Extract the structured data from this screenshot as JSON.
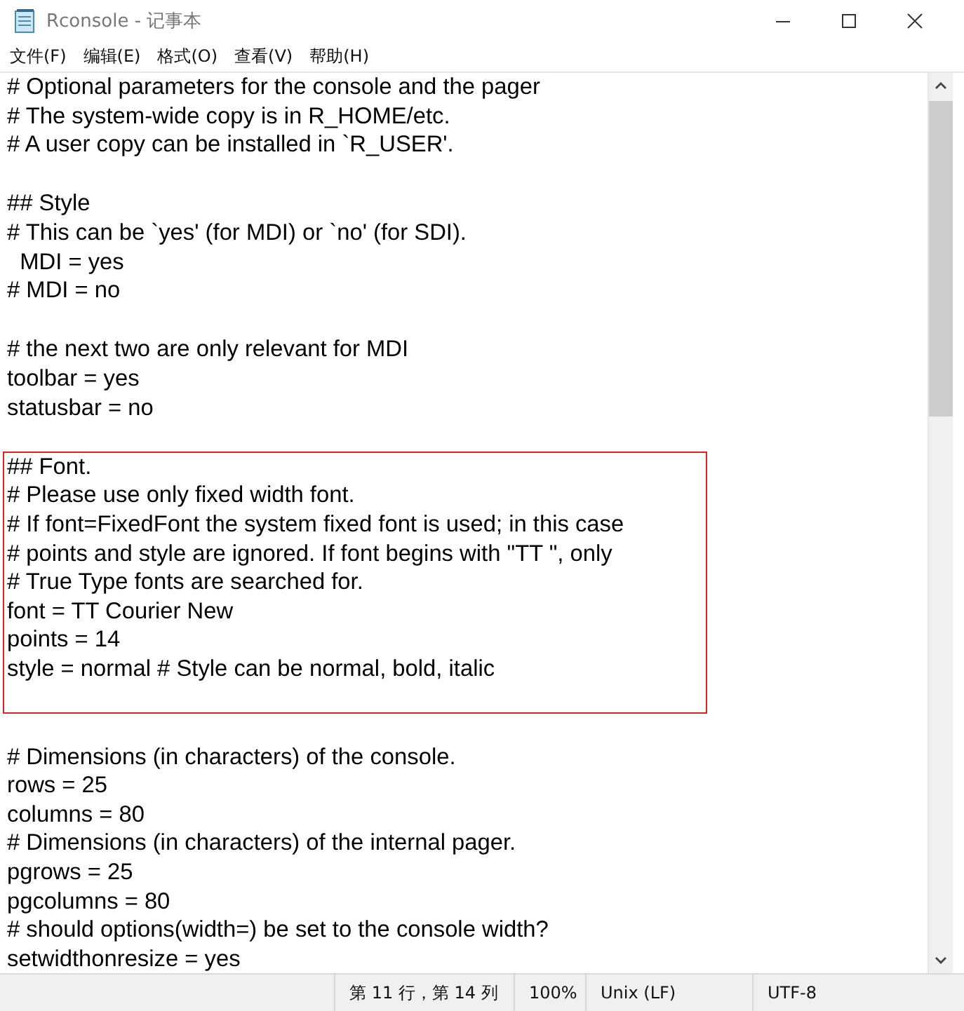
{
  "window": {
    "title": "Rconsole - 记事本"
  },
  "menu": [
    "文件(F)",
    "编辑(E)",
    "格式(O)",
    "查看(V)",
    "帮助(H)"
  ],
  "blocks": [
    {
      "highlighted": false,
      "lines": [
        {
          "kind": "text",
          "text": "# Optional parameters for the console and the pager"
        },
        {
          "kind": "text",
          "text": "# The system-wide copy is in R_HOME/etc."
        },
        {
          "kind": "text",
          "text": "# A user copy can be installed in `R_USER'."
        },
        {
          "kind": "blank"
        }
      ]
    },
    {
      "highlighted": false,
      "lines": [
        {
          "kind": "text",
          "text": "## Style"
        },
        {
          "kind": "text",
          "text": "# This can be `yes' (for MDI) or `no' (for SDI)."
        },
        {
          "kind": "text",
          "text": "  MDI = yes"
        },
        {
          "kind": "text",
          "text": "# MDI = no"
        },
        {
          "kind": "blank"
        }
      ]
    },
    {
      "highlighted": false,
      "lines": [
        {
          "kind": "text",
          "text": "# the next two are only relevant for MDI"
        },
        {
          "kind": "text",
          "text": "toolbar = yes"
        },
        {
          "kind": "text",
          "text": "statusbar = no"
        },
        {
          "kind": "blank"
        }
      ]
    },
    {
      "highlighted": true,
      "lines": [
        {
          "kind": "text",
          "text": "## Font."
        },
        {
          "kind": "text",
          "text": "# Please use only fixed width font."
        },
        {
          "kind": "text",
          "text": "# If font=FixedFont the system fixed font is used; in this case"
        },
        {
          "kind": "text",
          "text": "# points and style are ignored. If font begins with \"TT \", only"
        },
        {
          "kind": "text",
          "text": "# True Type fonts are searched for."
        },
        {
          "kind": "text",
          "text": "font = TT Courier New"
        },
        {
          "kind": "text",
          "text": "points = 14"
        },
        {
          "kind": "text",
          "text": "style = normal # Style can be normal, bold, italic"
        },
        {
          "kind": "blank"
        }
      ]
    },
    {
      "highlighted": false,
      "lines": [
        {
          "kind": "blank"
        },
        {
          "kind": "text",
          "text": "# Dimensions (in characters) of the console."
        },
        {
          "kind": "text",
          "text": "rows = 25"
        },
        {
          "kind": "text",
          "text": "columns = 80"
        },
        {
          "kind": "text",
          "text": "# Dimensions (in characters) of the internal pager."
        },
        {
          "kind": "text",
          "text": "pgrows = 25"
        },
        {
          "kind": "text",
          "text": "pgcolumns = 80"
        },
        {
          "kind": "text",
          "text": "# should options(width=) be set to the console width?"
        },
        {
          "kind": "text",
          "text": "setwidthonresize = yes"
        }
      ]
    }
  ],
  "status_bar": [
    "第 11 行，第 14 列",
    "100%",
    "Unix (LF)",
    "UTF-8"
  ]
}
